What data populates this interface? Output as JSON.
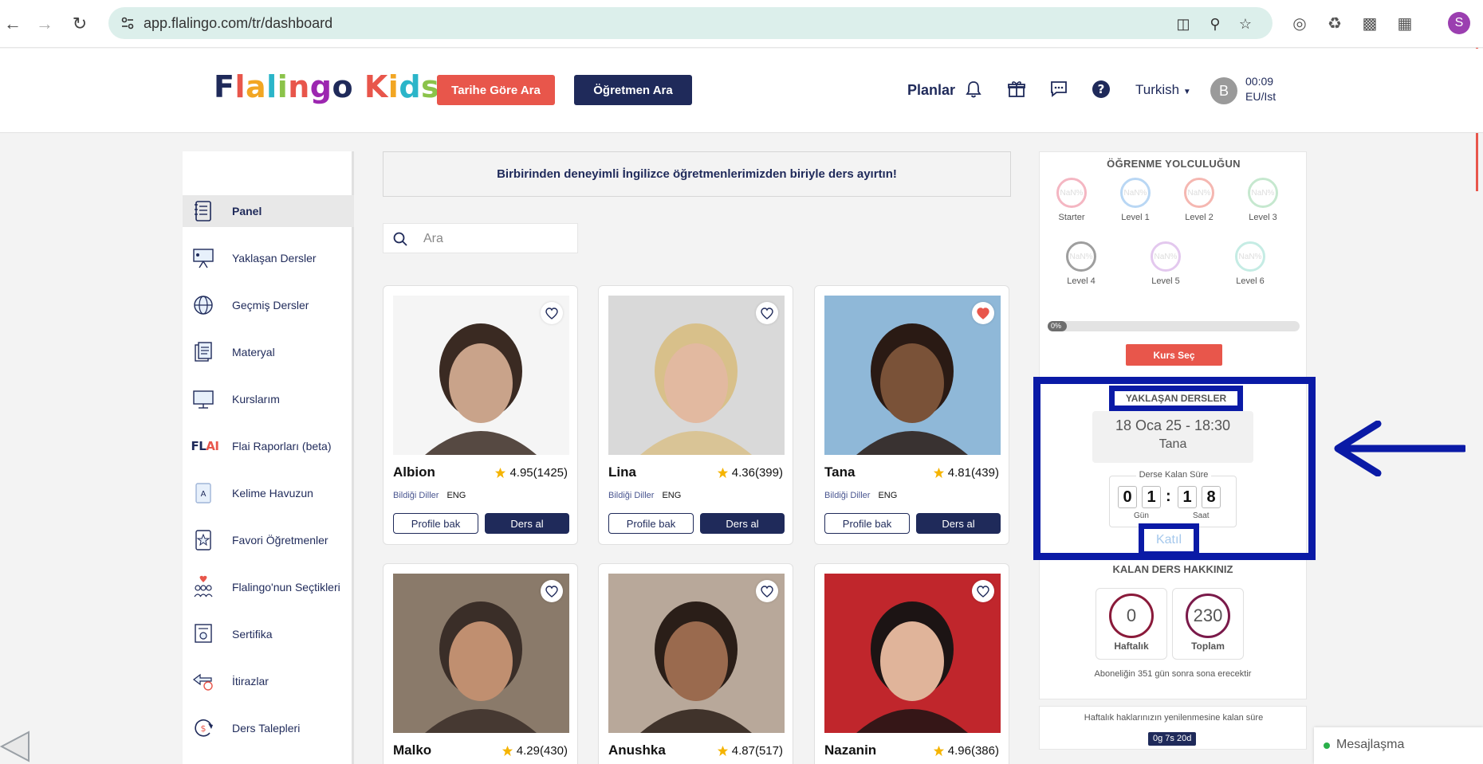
{
  "browser": {
    "url": "app.flalingo.com/tr/dashboard",
    "profile_initial": "S"
  },
  "header": {
    "logo_text": "Flalingo Kids",
    "logo_colors": [
      "#1f2a5a",
      "#e8564b",
      "#f2a623",
      "#2bb5c9",
      "#8bc34a",
      "#e8564b",
      "#9c27b0"
    ],
    "btn_date": "Tarihe Göre Ara",
    "btn_teacher": "Öğretmen Ara",
    "planlar": "Planlar",
    "language": "Turkish",
    "avatar_initial": "B",
    "time": "00:09",
    "timezone": "EU/Ist"
  },
  "sidebar": {
    "items": [
      {
        "label": "Panel",
        "icon": "notebook-icon"
      },
      {
        "label": "Yaklaşan Dersler",
        "icon": "presentation-icon"
      },
      {
        "label": "Geçmiş Dersler",
        "icon": "globe-icon"
      },
      {
        "label": "Materyal",
        "icon": "documents-icon"
      },
      {
        "label": "Kurslarım",
        "icon": "monitor-icon"
      },
      {
        "label": "Flai Raporları (beta)",
        "icon": "flai-logo-icon",
        "logo_text": "FLAI"
      },
      {
        "label": "Kelime Havuzun",
        "icon": "dictionary-icon"
      },
      {
        "label": "Favori Öğretmenler",
        "icon": "star-doc-icon"
      },
      {
        "label": "Flalingo'nun Seçtikleri",
        "icon": "group-heart-icon"
      },
      {
        "label": "Sertifika",
        "icon": "certificate-icon"
      },
      {
        "label": "İtirazlar",
        "icon": "exchange-icon"
      },
      {
        "label": "Ders Talepleri",
        "icon": "refresh-dollar-icon"
      }
    ]
  },
  "main": {
    "banner": "Birbirinden deneyimli İngilizce öğretmenlerimizden biriyle ders ayırtın!",
    "search_placeholder": "Ara",
    "langs_label": "Bildiği Diller",
    "profile_btn": "Profile bak",
    "lesson_btn": "Ders al",
    "teachers": [
      {
        "name": "Albion",
        "rating": "4.95",
        "reviews": "(1425)",
        "lang": "ENG",
        "favorite": false
      },
      {
        "name": "Lina",
        "rating": "4.36",
        "reviews": "(399)",
        "lang": "ENG",
        "favorite": false
      },
      {
        "name": "Tana",
        "rating": "4.81",
        "reviews": "(439)",
        "lang": "ENG",
        "favorite": true
      },
      {
        "name": "Malko",
        "rating": "4.29",
        "reviews": "(430)",
        "lang": "",
        "favorite": false
      },
      {
        "name": "Anushka",
        "rating": "4.87",
        "reviews": "(517)",
        "lang": "",
        "favorite": false
      },
      {
        "name": "Nazanin",
        "rating": "4.96",
        "reviews": "(386)",
        "lang": "",
        "favorite": false
      }
    ]
  },
  "right": {
    "journey_title": "ÖĞRENME YOLCULUĞUN",
    "levels": [
      {
        "name": "Starter",
        "value": "NaN%",
        "color": "#f4b6c2"
      },
      {
        "name": "Level 1",
        "value": "NaN%",
        "color": "#b9d7f4"
      },
      {
        "name": "Level 2",
        "value": "NaN%",
        "color": "#f5b7b1"
      },
      {
        "name": "Level 3",
        "value": "NaN%",
        "color": "#c6e8cf"
      },
      {
        "name": "Level 4",
        "value": "NaN%",
        "color": "#9e9e9e"
      },
      {
        "name": "Level 5",
        "value": "NaN%",
        "color": "#e3c8ee"
      },
      {
        "name": "Level 6",
        "value": "NaN%",
        "color": "#c5ece4"
      }
    ],
    "progress_pct": "0%",
    "progress_value": 0,
    "course_btn": "Kurs Seç",
    "upcoming_title": "YAKLAŞAN DERSLER",
    "lesson_date": "18 Oca 25 - 18:30",
    "lesson_teacher": "Tana",
    "countdown_title": "Derse Kalan Süre",
    "digits": [
      "0",
      "1",
      "1",
      "8"
    ],
    "day_label": "Gün",
    "hour_label": "Saat",
    "join_btn": "Katıl",
    "remaining_title": "KALAN DERS HAKKINIZ",
    "weekly_count": "0",
    "weekly_label": "Haftalık",
    "total_count": "230",
    "total_label": "Toplam",
    "subscription_note": "Aboneliğin 351 gün sonra sona erecektir",
    "renew_text": "Haftalık haklarınızın yenilenmesine kalan süre",
    "renew_badge": "0g 7s 20d"
  },
  "messaging": "Mesajlaşma",
  "colors": {
    "navy": "#1f2a5a",
    "coral": "#e8564b",
    "annotation_blue": "#0a1aa6"
  }
}
